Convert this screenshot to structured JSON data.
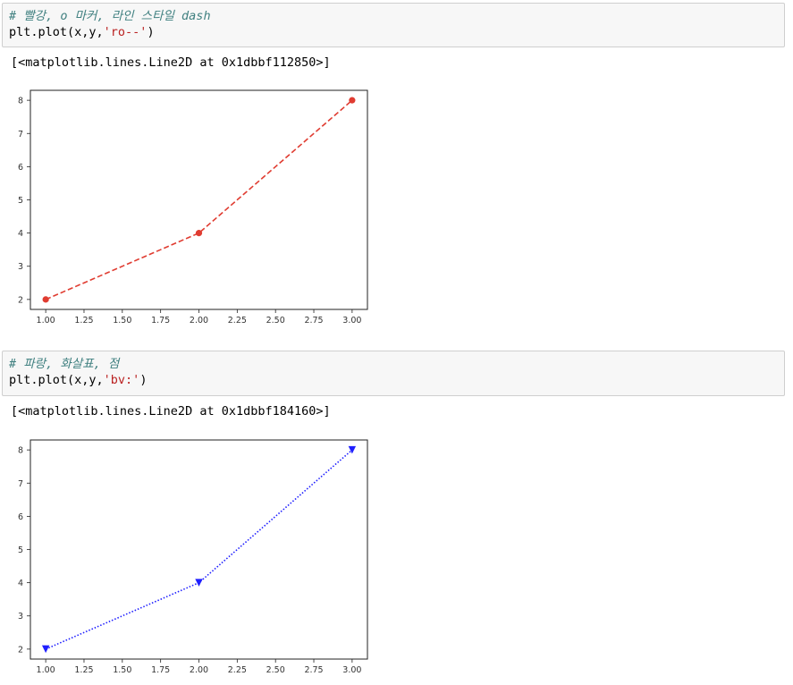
{
  "cells": [
    {
      "comment": "# 빨강, o 마커, 라인 스타일 dash",
      "code_prefix": "plt.plot(x,y,",
      "code_string": "'ro--'",
      "code_suffix": ")",
      "output_text": "[<matplotlib.lines.Line2D at 0x1dbbf112850>]"
    },
    {
      "comment": "# 파랑, 화살표, 점",
      "code_prefix": "plt.plot(x,y,",
      "code_string": "'bv:'",
      "code_suffix": ")",
      "output_text": "[<matplotlib.lines.Line2D at 0x1dbbf184160>]"
    }
  ],
  "chart_data": [
    {
      "type": "line",
      "x": [
        1,
        2,
        3
      ],
      "y": [
        2,
        4,
        8
      ],
      "xlim": [
        0.9,
        3.1
      ],
      "ylim": [
        1.7,
        8.3
      ],
      "xticks": [
        "1.00",
        "1.25",
        "1.50",
        "1.75",
        "2.00",
        "2.25",
        "2.50",
        "2.75",
        "3.00"
      ],
      "xtick_values": [
        1.0,
        1.25,
        1.5,
        1.75,
        2.0,
        2.25,
        2.5,
        2.75,
        3.0
      ],
      "yticks": [
        "2",
        "3",
        "4",
        "5",
        "6",
        "7",
        "8"
      ],
      "ytick_values": [
        2,
        3,
        4,
        5,
        6,
        7,
        8
      ],
      "color": "#e03c31",
      "marker": "o",
      "linestyle": "dashed",
      "grid": false
    },
    {
      "type": "line",
      "x": [
        1,
        2,
        3
      ],
      "y": [
        2,
        4,
        8
      ],
      "xlim": [
        0.9,
        3.1
      ],
      "ylim": [
        1.7,
        8.3
      ],
      "xticks": [
        "1.00",
        "1.25",
        "1.50",
        "1.75",
        "2.00",
        "2.25",
        "2.50",
        "2.75",
        "3.00"
      ],
      "xtick_values": [
        1.0,
        1.25,
        1.5,
        1.75,
        2.0,
        2.25,
        2.5,
        2.75,
        3.0
      ],
      "yticks": [
        "2",
        "3",
        "4",
        "5",
        "6",
        "7",
        "8"
      ],
      "ytick_values": [
        2,
        3,
        4,
        5,
        6,
        7,
        8
      ],
      "color": "#1f1fff",
      "marker": "v",
      "linestyle": "dotted",
      "grid": false
    }
  ]
}
